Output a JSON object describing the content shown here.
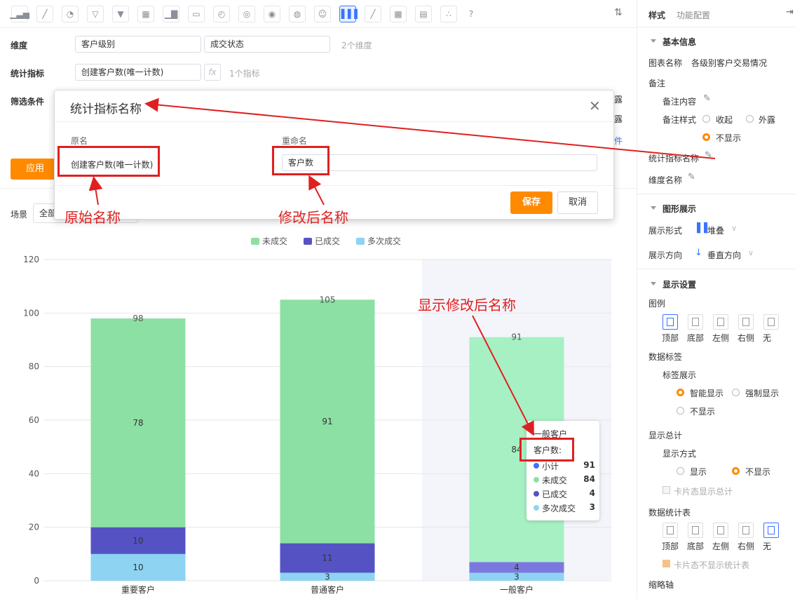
{
  "toolbar": {
    "icons": [
      "bar-chart",
      "line-chart",
      "pie-chart",
      "funnel",
      "funnel-alt",
      "table",
      "combo-chart",
      "card",
      "gauge",
      "map-cn",
      "map-cn-alt",
      "world-map",
      "smiley",
      "stacked-bar",
      "area-line",
      "heatmap",
      "detail-table",
      "scatter",
      "help"
    ],
    "active_icon": "stacked-bar"
  },
  "form": {
    "dimension_label": "维度",
    "dimension_values": [
      "客户级别",
      "成交状态"
    ],
    "dimension_count": "2个维度",
    "metric_label": "统计指标",
    "metric_value": "创建客户数(唯一计数)",
    "fx_label": "fx",
    "metric_count": "1个指标",
    "filter_label": "筛选条件",
    "apply_label": "应用",
    "scene_label": "场景",
    "scene_value": "全部",
    "bg_fragments": [
      "露",
      "露",
      "件"
    ]
  },
  "modal": {
    "title": "统计指标名称",
    "orig_header": "原名",
    "rename_header": "重命名",
    "orig_value": "创建客户数(唯一计数)",
    "rename_value": "客户数",
    "save_label": "保存",
    "cancel_label": "取消"
  },
  "annotations": {
    "original_name": "原始名称",
    "renamed": "修改后名称",
    "show_renamed": "显示修改后名称"
  },
  "chart_data": {
    "type": "bar",
    "stacked": true,
    "categories": [
      "重要客户",
      "普通客户",
      "一般客户"
    ],
    "series": [
      {
        "name": "多次成交",
        "values": [
          10,
          3,
          3
        ],
        "color": "#8ed3f2"
      },
      {
        "name": "已成交",
        "values": [
          10,
          11,
          4
        ],
        "color": "#5553c4"
      },
      {
        "name": "未成交",
        "values": [
          78,
          91,
          84
        ],
        "color": "#8de0a4"
      }
    ],
    "totals": [
      98,
      105,
      91
    ],
    "legend_order": [
      "未成交",
      "已成交",
      "多次成交"
    ],
    "ylim": [
      0,
      120
    ],
    "yticks": [
      0,
      20,
      40,
      60,
      80,
      100,
      120
    ],
    "legend_placement": "top",
    "grid": true,
    "highlight_category": "一般客户"
  },
  "tooltip": {
    "title": "一般客户",
    "metric": "客户数:",
    "rows": [
      {
        "name": "小计",
        "value": "91",
        "color": "#3b72ff"
      },
      {
        "name": "未成交",
        "value": "84",
        "color": "#8de0a4"
      },
      {
        "name": "已成交",
        "value": "4",
        "color": "#5553c4"
      },
      {
        "name": "多次成交",
        "value": "3",
        "color": "#8ed3f2"
      }
    ]
  },
  "panel": {
    "tab_style": "样式",
    "tab_config": "功能配置",
    "basic_info": "基本信息",
    "chart_name_label": "图表名称",
    "chart_name": "各级别客户交易情况",
    "remark_label": "备注",
    "remark_content": "备注内容",
    "remark_style": "备注样式",
    "remark_options": [
      "收起",
      "外露",
      "不显示"
    ],
    "metric_name": "统计指标名称",
    "dimension_name": "维度名称",
    "graph_display": "图形展示",
    "display_form_label": "展示形式",
    "display_form": "堆叠",
    "display_dir_label": "展示方向",
    "display_dir": "垂直方向",
    "display_settings": "显示设置",
    "legend_label": "图例",
    "legend_positions": [
      "顶部",
      "底部",
      "左侧",
      "右侧",
      "无"
    ],
    "data_label": "数据标签",
    "label_display": "标签展示",
    "label_options": [
      "智能显示",
      "强制显示",
      "不显示"
    ],
    "show_total": "显示总计",
    "show_mode": "显示方式",
    "show_options": [
      "显示",
      "不显示"
    ],
    "card_total": "卡片态显示总计",
    "data_table": "数据统计表",
    "table_positions": [
      "顶部",
      "底部",
      "左侧",
      "右侧",
      "无"
    ],
    "card_no_table": "卡片态不显示统计表",
    "zoom_axis": "缩略轴"
  }
}
